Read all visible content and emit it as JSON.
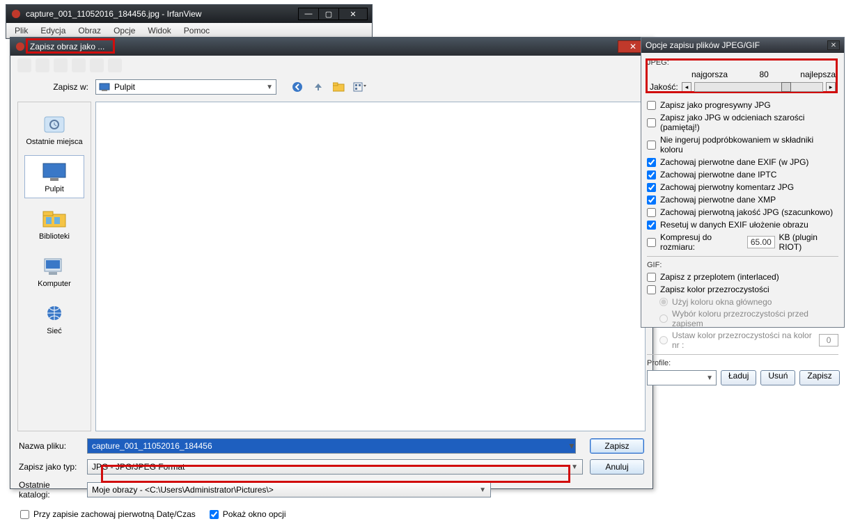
{
  "main": {
    "title": "capture_001_11052016_184456.jpg - IrfanView",
    "menu": [
      "Plik",
      "Edycja",
      "Obraz",
      "Opcje",
      "Widok",
      "Pomoc"
    ]
  },
  "dialog": {
    "title": "Zapisz obraz jako ...",
    "save_in_label": "Zapisz w:",
    "save_in_value": "Pulpit",
    "places": [
      {
        "label": "Ostatnie miejsca"
      },
      {
        "label": "Pulpit"
      },
      {
        "label": "Biblioteki"
      },
      {
        "label": "Komputer"
      },
      {
        "label": "Sieć"
      }
    ],
    "filename_label": "Nazwa pliku:",
    "filename_value": "capture_001_11052016_184456",
    "type_label": "Zapisz jako typ:",
    "type_value": "JPG - JPG/JPEG Format",
    "recent_label": "Ostatnie katalogi:",
    "recent_value": "Moje obrazy  -  <C:\\Users\\Administrator\\Pictures\\>",
    "save_btn": "Zapisz",
    "cancel_btn": "Anuluj",
    "keep_date": "Przy zapisie zachowaj pierwotną Datę/Czas",
    "show_options": "Pokaż okno opcji"
  },
  "opts": {
    "title": "Opcje zapisu plików JPEG/GIF",
    "jpeg_label": "JPEG:",
    "worst": "najgorsza",
    "best": "najlepsza",
    "quality_label": "Jakość:",
    "quality_value": "80",
    "checks": {
      "progressive": "Zapisz jako progresywny JPG",
      "grayscale": "Zapisz jako JPG w odcieniach szarości  (pamiętaj!)",
      "subsample": "Nie ingeruj podpróbkowaniem w składniki koloru",
      "exif": "Zachowaj pierwotne dane EXIF (w JPG)",
      "iptc": "Zachowaj pierwotne dane IPTC",
      "comment": "Zachowaj pierwotny komentarz JPG",
      "xmp": "Zachowaj pierwotne dane XMP",
      "quality_est": "Zachowaj pierwotną jakość JPG  (szacunkowo)",
      "reset_orient": "Resetuj w danych EXIF ułożenie obrazu",
      "compress_to": "Kompresuj do rozmiaru:",
      "compress_val": "65.00",
      "compress_unit": "KB (plugin RIOT)"
    },
    "gif_label": "GIF:",
    "gif": {
      "interlaced": "Zapisz z przeplotem (interlaced)",
      "trans": "Zapisz kolor przezroczystości",
      "use_main": "Użyj koloru okna głównego",
      "pick_before": "Wybór koloru przezroczystości przed zapisem",
      "set_index": "Ustaw kolor przezroczystości na kolor nr :",
      "index_val": "0"
    },
    "profile_label": "Profile:",
    "load": "Ładuj",
    "remove": "Usuń",
    "save": "Zapisz"
  }
}
